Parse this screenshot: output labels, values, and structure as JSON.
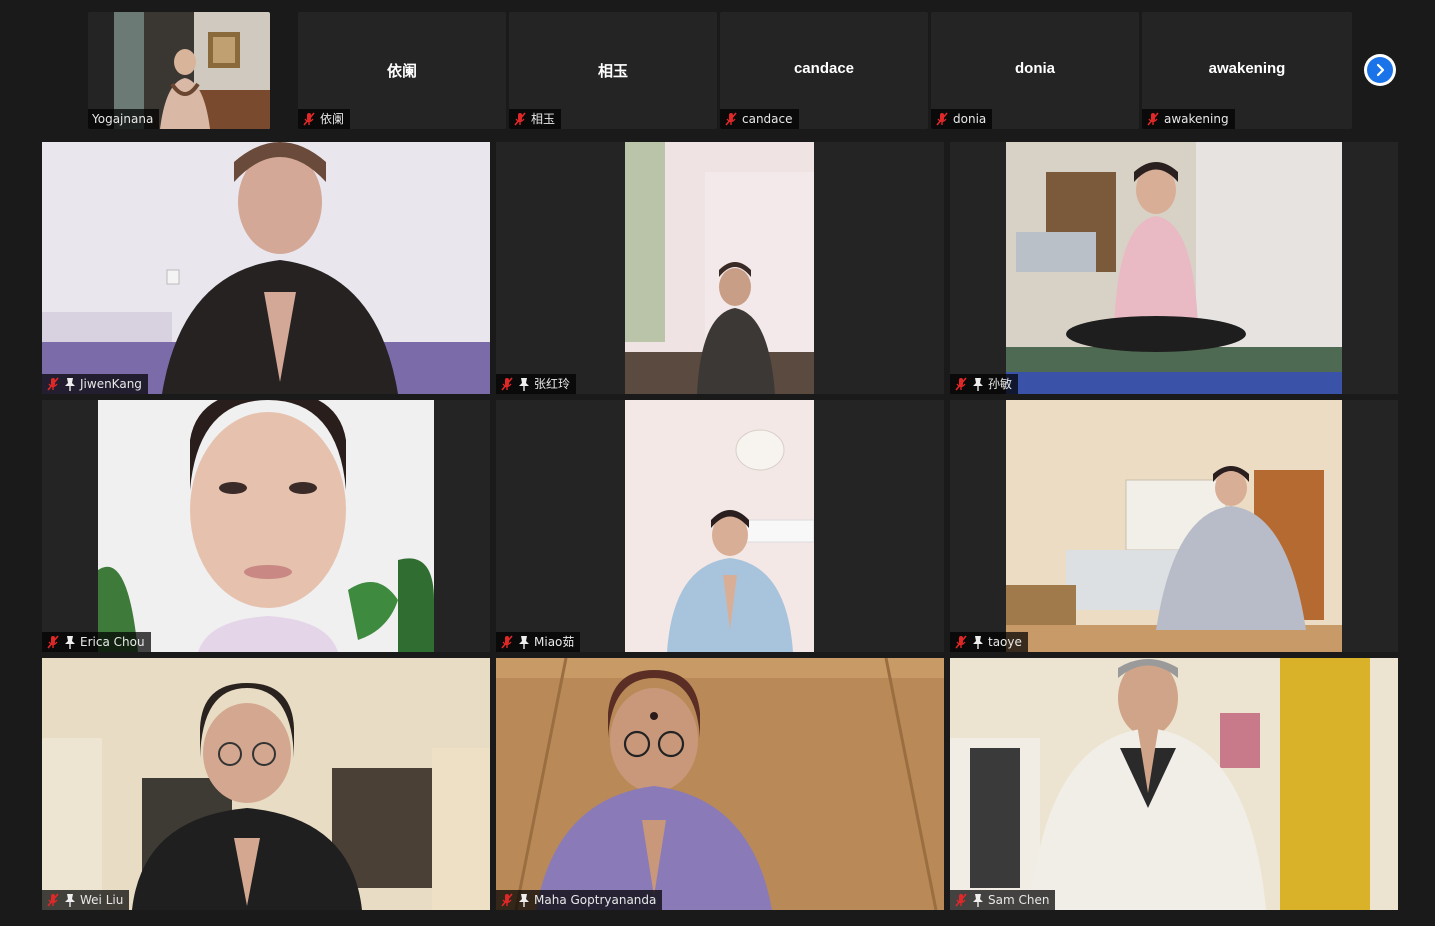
{
  "strip": {
    "participants": [
      {
        "name": "Yogajnana",
        "has_video": true
      },
      {
        "name": "依阑",
        "display": "依阑",
        "has_video": false
      },
      {
        "name": "相玉",
        "display": "相玉",
        "has_video": false
      },
      {
        "name": "candace",
        "display": "candace",
        "has_video": false
      },
      {
        "name": "donia",
        "display": "donia",
        "has_video": false
      },
      {
        "name": "awakening",
        "display": "awakening",
        "has_video": false
      }
    ],
    "next_icon": "chevron-right-icon"
  },
  "grid": {
    "tiles": [
      {
        "name": "JiwenKang"
      },
      {
        "name": "张红玲"
      },
      {
        "name": "孙敏"
      },
      {
        "name": "Erica Chou"
      },
      {
        "name": "Miao茹"
      },
      {
        "name": "taoye"
      },
      {
        "name": "Wei Liu"
      },
      {
        "name": "Maha Goptryananda"
      },
      {
        "name": "Sam Chen"
      }
    ]
  },
  "colors": {
    "background": "#1a1a1a",
    "tile": "#242424",
    "mic_muted": "#e02828",
    "accent_button": "#1a73e8"
  }
}
